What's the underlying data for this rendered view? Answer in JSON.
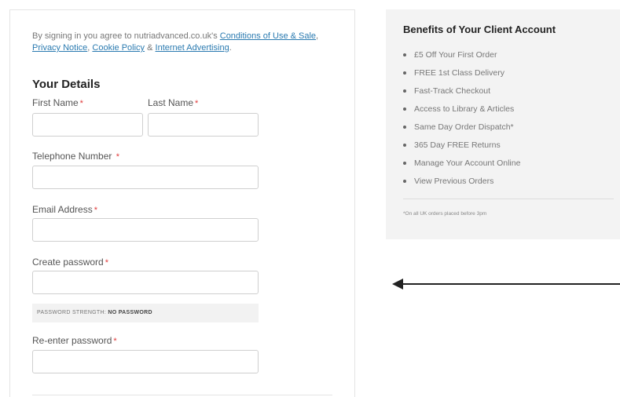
{
  "agreement": {
    "prefix": "By signing in you agree to nutriadvanced.co.uk's ",
    "conditions_link": "Conditions of Use & Sale",
    "sep1": ",",
    "privacy_link": "Privacy Notice",
    "sep2": ", ",
    "cookie_link": "Cookie Policy",
    "sep3": " & ",
    "advertising_link": "Internet Advertising",
    "suffix": "."
  },
  "form": {
    "title": "Your Details",
    "required_marker": "*",
    "first_name_label": "First Name",
    "last_name_label": "Last Name",
    "telephone_label": "Telephone Number",
    "email_label": "Email Address",
    "password_label": "Create password",
    "password_strength_prefix": "PASSWORD STRENGTH: ",
    "password_strength_value": "NO PASSWORD",
    "reenter_password_label": "Re-enter password"
  },
  "benefits": {
    "title": "Benefits of Your Client Account",
    "items": [
      "£5 Off Your First Order",
      "FREE 1st Class Delivery",
      "Fast-Track Checkout",
      "Access to Library & Articles",
      "Same Day Order Dispatch*",
      "365 Day FREE Returns",
      "Manage Your Account Online",
      "View Previous Orders"
    ],
    "footnote": "*On all UK orders placed before 3pm"
  },
  "colors": {
    "link": "#2a7ab0",
    "required": "#e03a3a",
    "benefits_bg": "#f3f3f3"
  }
}
